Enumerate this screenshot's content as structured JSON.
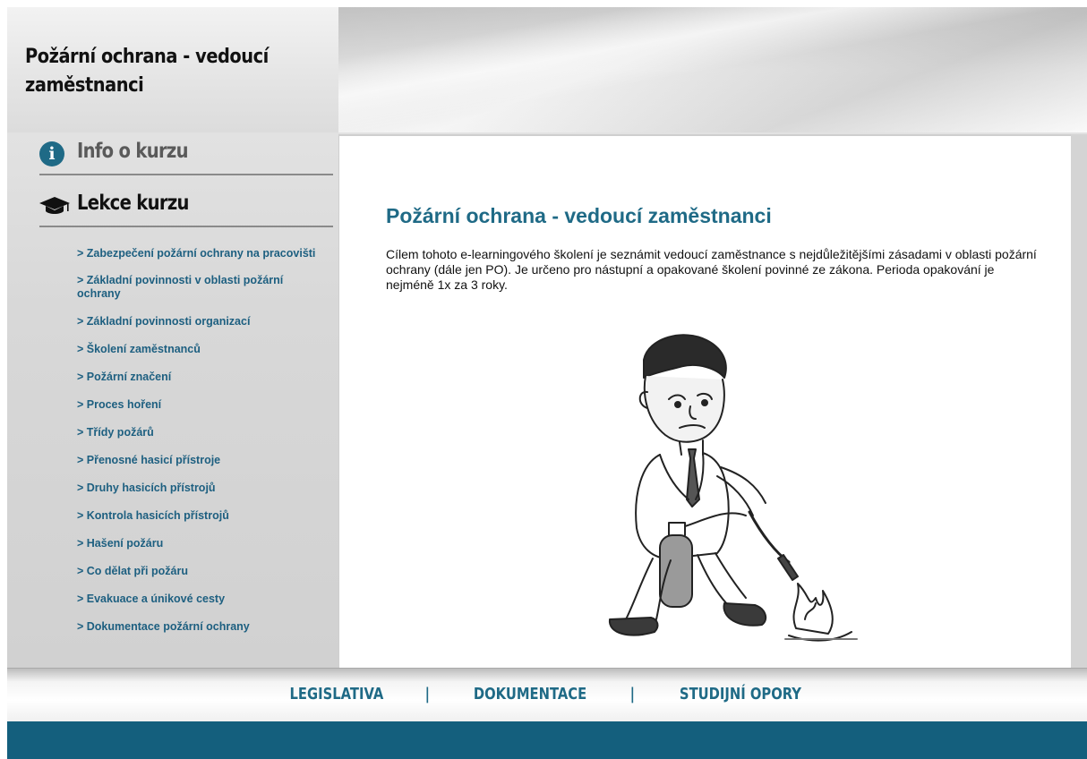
{
  "header": {
    "title": "Požární ochrana - vedoucí zaměstnanci"
  },
  "sidebar": {
    "info": {
      "label": "Info o kurzu",
      "icon": "info-icon"
    },
    "lessons": {
      "label": "Lekce kurzu",
      "icon": "graduation-cap-icon"
    },
    "items": [
      "> Zabezpečení požární ochrany na pracovišti",
      "> Základní povinnosti v oblasti požární ochrany",
      "> Základní povinnosti organizací",
      "> Školení zaměstnanců",
      "> Požární značení",
      "> Proces hoření",
      "> Třídy požárů",
      "> Přenosné hasicí přístroje",
      "> Druhy hasicích přístrojů",
      "> Kontrola hasicích přístrojů",
      "> Hašení požáru",
      "> Co dělat při požáru",
      "> Evakuace a únikové cesty",
      "> Dokumentace požární ochrany"
    ]
  },
  "content": {
    "title": "Požární ochrana - vedoucí zaměstnanci",
    "text": "Cílem tohoto e-learningového školení je seznámit vedoucí zaměstnance s nejdůležitějšími zásadami v oblasti požární ochrany (dále jen PO). Je určeno pro nástupní a opakované školení povinné ze zákona. Perioda opakování je nejméně 1x za 3 roky."
  },
  "footer": {
    "links": [
      "LEGISLATIVA",
      "DOKUMENTACE",
      "STUDIJNÍ OPORY"
    ],
    "separator": "|"
  },
  "colors": {
    "accent": "#1f6a86",
    "link": "#1d5f80",
    "footer_bar": "#145f7d"
  }
}
